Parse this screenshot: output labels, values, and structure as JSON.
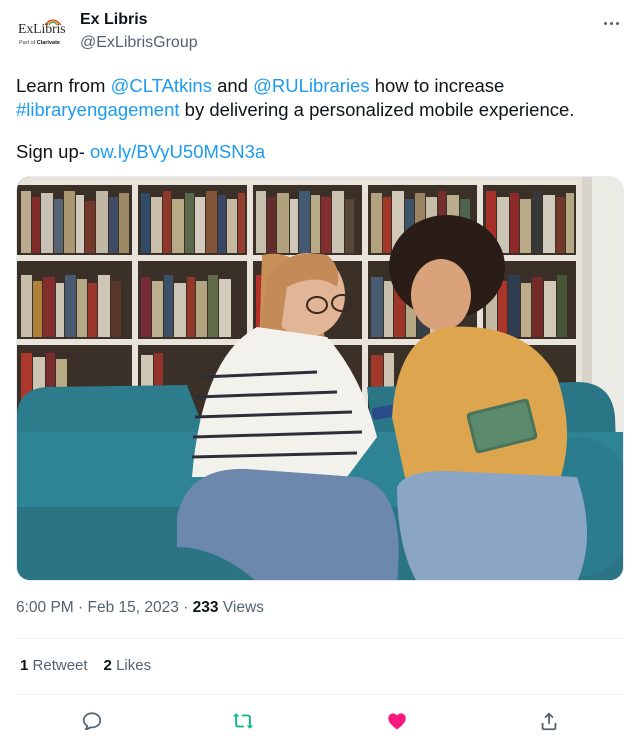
{
  "account": {
    "display_name": "Ex Libris",
    "handle": "@ExLibrisGroup",
    "avatar_logo_text": "ExLibris",
    "avatar_logo_sub": "Part of",
    "avatar_logo_brand": "Clarivate"
  },
  "tweet": {
    "seg_1": "Learn from ",
    "mention_1": "@CLTAtkins",
    "seg_2": " and ",
    "mention_2": "@RULibraries",
    "seg_3": " how to increase ",
    "hashtag": "#libraryengagement",
    "seg_4": " by delivering a personalized mobile experience.",
    "signup_label": "Sign up- ",
    "signup_link": "ow.ly/BVyU50MSN3a"
  },
  "meta": {
    "time": "6:00 PM",
    "sep_1": " · ",
    "date": "Feb 15, 2023",
    "sep_2": " · ",
    "views_count": "233",
    "views_label": " Views"
  },
  "stats": {
    "retweets_count": "1",
    "retweets_label": "Retweet",
    "likes_count": "2",
    "likes_label": "Likes"
  },
  "icons": {
    "reply": "reply-icon",
    "retweet": "retweet-icon",
    "like": "heart-icon",
    "share": "share-icon",
    "more": "more-icon"
  },
  "colors": {
    "link": "#1d9bf0",
    "retweet_active": "#00ba7c",
    "like_active": "#f91880",
    "secondary_text": "#536471"
  }
}
